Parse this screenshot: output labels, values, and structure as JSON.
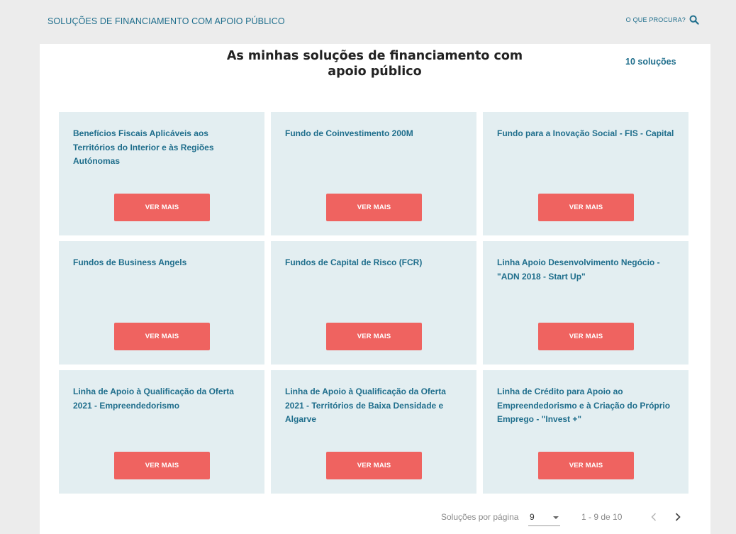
{
  "header": {
    "title": "SOLUÇÕES DE FINANCIAMENTO COM APOIO PÚBLICO",
    "search_label": "O QUE PROCURA?",
    "search_icon": "search-icon"
  },
  "main": {
    "title_line1": "As minhas soluções de financiamento com",
    "title_line2": "apoio público",
    "count": "10 soluções"
  },
  "cards": [
    {
      "title": "Benefícios Fiscais Aplicáveis aos Territórios do Interior e às Regiões Autónomas",
      "button": "VER MAIS"
    },
    {
      "title": "Fundo de Coinvestimento 200M",
      "button": "VER MAIS"
    },
    {
      "title": "Fundo para a Inovação Social - FIS - Capital",
      "button": "VER MAIS"
    },
    {
      "title": "Fundos de Business Angels",
      "button": "VER MAIS"
    },
    {
      "title": "Fundos de Capital de Risco (FCR)",
      "button": "VER MAIS"
    },
    {
      "title": "Linha Apoio Desenvolvimento Negócio - \"ADN 2018 - Start Up\"",
      "button": "VER MAIS"
    },
    {
      "title": "Linha de Apoio à Qualificação da Oferta 2021 - Empreendedorismo",
      "button": "VER MAIS"
    },
    {
      "title": "Linha de Apoio à Qualificação da Oferta 2021 - Territórios de Baixa Densidade e Algarve",
      "button": "VER MAIS"
    },
    {
      "title": "Linha de Crédito para Apoio ao Empreendedorismo e à Criação do Próprio Emprego - \"Invest +\"",
      "button": "VER MAIS"
    }
  ],
  "pagination": {
    "per_page_label": "Soluções por página",
    "per_page_value": "9",
    "range": "1 - 9 de 10",
    "prev_icon": "chevron-left-icon",
    "next_icon": "chevron-right-icon"
  },
  "colors": {
    "accent": "#1f6e8c",
    "button": "#ef6360",
    "card_bg": "#e3eef1",
    "page_bg": "#ececec"
  }
}
